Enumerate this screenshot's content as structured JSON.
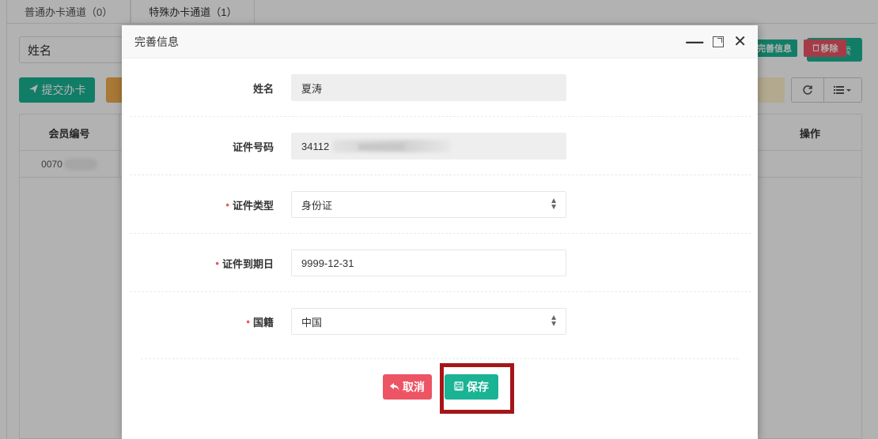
{
  "page": {
    "tabs": [
      {
        "label": "普通办卡通道（0）"
      },
      {
        "label": "特殊办卡通道（1）"
      }
    ],
    "search_label": "姓名",
    "search_button": "搜索",
    "submit_button": "提交办卡",
    "table": {
      "headers": {
        "member_no": "会员编号",
        "actions": "操作"
      },
      "rows": [
        {
          "member_no": "0070"
        }
      ],
      "row_actions": {
        "complete": "完善信息",
        "remove": "移除"
      }
    }
  },
  "modal": {
    "title": "完善信息",
    "fields": {
      "name": {
        "label": "姓名",
        "value": "夏涛",
        "required": false
      },
      "id_number": {
        "label": "证件号码",
        "value": "34112",
        "required": false
      },
      "id_type": {
        "label": "证件类型",
        "value": "身份证",
        "required": true
      },
      "expiry": {
        "label": "证件到期日",
        "value": "9999-12-31",
        "required": true
      },
      "nationality": {
        "label": "国籍",
        "value": "中国",
        "required": true
      }
    },
    "required_mark": "•",
    "cancel_button": "取消",
    "save_button": "保存"
  },
  "colors": {
    "primary": "#1ab394",
    "danger": "#ed5565",
    "highlight": "#a51618"
  }
}
